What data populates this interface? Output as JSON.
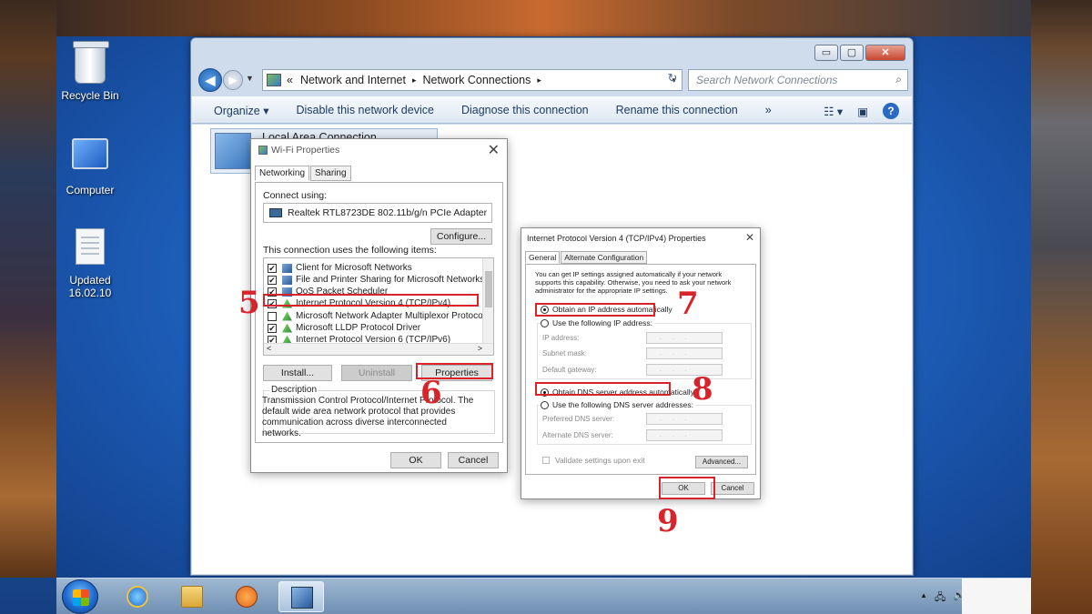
{
  "desktop": {
    "icons": [
      {
        "label": "Recycle Bin"
      },
      {
        "label": "Computer"
      },
      {
        "label": "Updated\n16.02.10"
      }
    ]
  },
  "explorer": {
    "caption": {
      "minimize": "▭",
      "maximize": "▢",
      "close": "✕"
    },
    "nav": {
      "back": "◀",
      "forward": "▶",
      "recent": "▼"
    },
    "address": {
      "prefix": "«",
      "crumbs": [
        "Network and Internet",
        "Network Connections"
      ],
      "separator": "▸",
      "dropdown": "▾"
    },
    "refresh": "↻",
    "search": {
      "placeholder": "Search Network Connections",
      "icon": "⌕"
    },
    "toolbar": {
      "organize": "Organize ▾",
      "disable": "Disable this network device",
      "diagnose": "Diagnose this connection",
      "rename": "Rename this connection",
      "more": "»",
      "view": "☷ ▾",
      "pane": "▣",
      "help": "?"
    },
    "item": {
      "title": "Local Area Connection"
    }
  },
  "wifi_dialog": {
    "title": "Wi-Fi Properties",
    "close": "✕",
    "tabs": [
      "Networking",
      "Sharing"
    ],
    "connect_using_label": "Connect using:",
    "adapter": "Realtek RTL8723DE 802.11b/g/n PCIe Adapter",
    "configure": "Configure...",
    "items_label": "This connection uses the following items:",
    "items": [
      {
        "label": "Client for Microsoft Networks",
        "checked": true
      },
      {
        "label": "File and Printer Sharing for Microsoft Networks",
        "checked": true
      },
      {
        "label": "QoS Packet Scheduler",
        "checked": true
      },
      {
        "label": "Internet Protocol Version 4 (TCP/IPv4)",
        "checked": true
      },
      {
        "label": "Microsoft Network Adapter Multiplexor Protocol",
        "checked": false
      },
      {
        "label": "Microsoft LLDP Protocol Driver",
        "checked": true
      },
      {
        "label": "Internet Protocol Version 6 (TCP/IPv6)",
        "checked": true
      }
    ],
    "check_mark": "✔",
    "scroll_left": "<",
    "scroll_right": ">",
    "install": "Install...",
    "uninstall": "Uninstall",
    "properties": "Properties",
    "description_label": "Description",
    "description": "Transmission Control Protocol/Internet Protocol. The default wide area network protocol that provides communication across diverse interconnected networks.",
    "ok": "OK",
    "cancel": "Cancel"
  },
  "ipv4_dialog": {
    "title": "Internet Protocol Version 4 (TCP/IPv4) Properties",
    "close": "✕",
    "tabs": [
      "General",
      "Alternate Configuration"
    ],
    "intro": "You can get IP settings assigned automatically if your network supports this capability. Otherwise, you need to ask your network administrator for the appropriate IP settings.",
    "obtain_ip": "Obtain an IP address automatically",
    "use_ip": "Use the following IP address:",
    "ip_address": "IP address:",
    "subnet_mask": "Subnet mask:",
    "default_gateway": "Default gateway:",
    "obtain_dns": "Obtain DNS server address automatically",
    "use_dns": "Use the following DNS server addresses:",
    "preferred_dns": "Preferred DNS server:",
    "alternate_dns": "Alternate DNS server:",
    "dots": ". . .",
    "validate": "Validate settings upon exit",
    "advanced": "Advanced...",
    "ok": "OK",
    "cancel": "Cancel"
  },
  "steps": [
    "5",
    "6",
    "7",
    "8",
    "9"
  ],
  "taskbar": {
    "apps": [
      "internet-explorer",
      "file-explorer",
      "media-player",
      "network-connections"
    ],
    "tray": {
      "arrow": "▲",
      "network": "🖧",
      "volume": "🔊"
    }
  }
}
